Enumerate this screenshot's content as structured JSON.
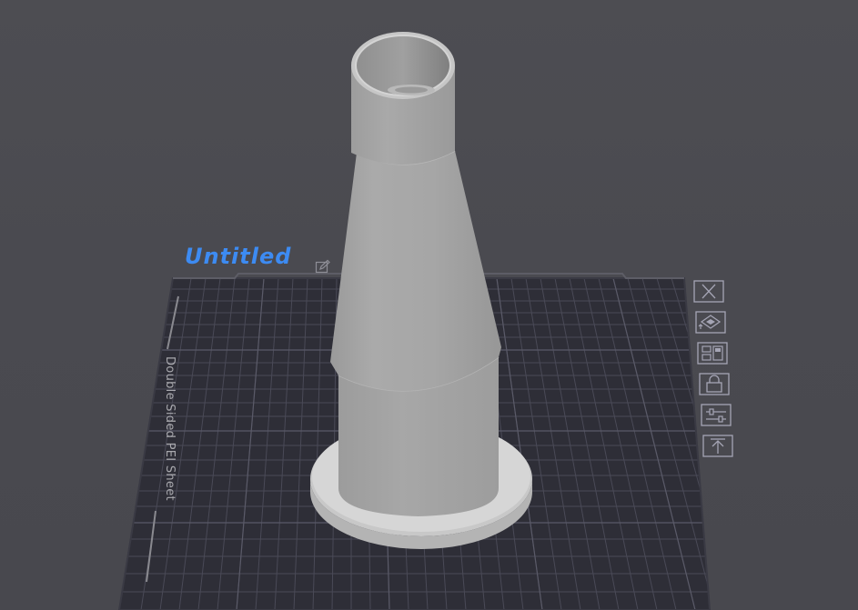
{
  "plate": {
    "title": "Untitled",
    "sheet_label": "Double Sided PEI Sheet"
  },
  "toolbar": {
    "buttons": [
      {
        "name": "delete-plate-button",
        "icon": "close-icon"
      },
      {
        "name": "orient-plate-button",
        "icon": "orient-icon"
      },
      {
        "name": "arrange-plate-button",
        "icon": "arrange-icon"
      },
      {
        "name": "lock-plate-button",
        "icon": "lock-icon"
      },
      {
        "name": "plate-settings-button",
        "icon": "sliders-icon"
      },
      {
        "name": "move-to-top-button",
        "icon": "arrow-up-icon"
      }
    ]
  },
  "colors": {
    "background": "#4a4a4f",
    "plate": "#2f2f38",
    "grid": "#4c4c58",
    "title_accent": "#3d8bf2",
    "model": "#a6a6a6",
    "toolbar_icon": "#a5a5b5"
  }
}
